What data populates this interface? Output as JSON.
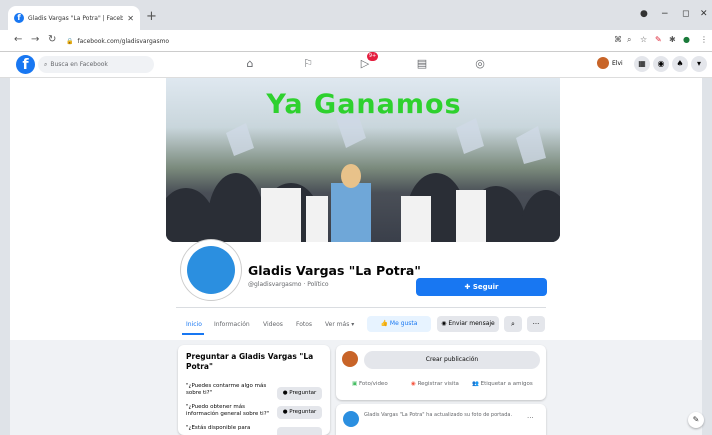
{
  "browser": {
    "tab_title": "Gladis Vargas \"La Potra\" | Facebo...",
    "url": "facebook.com/gladisvargasmo"
  },
  "fb_header": {
    "search_placeholder": "Busca en Facebook",
    "notification_count": "9+",
    "profile_name": "Elvi"
  },
  "cover": {
    "text": "Ya Ganamos",
    "text_color": "#2ed12e"
  },
  "profile": {
    "name": "Gladis Vargas \"La Potra\"",
    "handle": "@gladisvargasmo · Político",
    "follow_label": "Seguir"
  },
  "tabs": [
    "Inicio",
    "Información",
    "Videos",
    "Fotos",
    "Ver más ▾"
  ],
  "actions": {
    "like_label": "Me gusta",
    "message_label": "Enviar mensaje"
  },
  "ask_card": {
    "title": "Preguntar a Gladis Vargas \"La Potra\"",
    "questions": [
      "\"¿Puedes contarme algo más sobre ti?\"",
      "\"¿Puedo obtener más información general sobre ti?\"",
      "\"¿Estás disponible para"
    ],
    "ask_label": "Preguntar"
  },
  "publish_card": {
    "button_label": "Crear publicación",
    "actions": [
      "Foto/video",
      "Registrar visita",
      "Etiquetar a amigos"
    ]
  },
  "post": {
    "text": "Gladis Vargas \"La Potra\" ha actualizado su foto de portada."
  },
  "colors": {
    "facebook_blue": "#1877f2",
    "page_background": "#f0f2f5"
  }
}
